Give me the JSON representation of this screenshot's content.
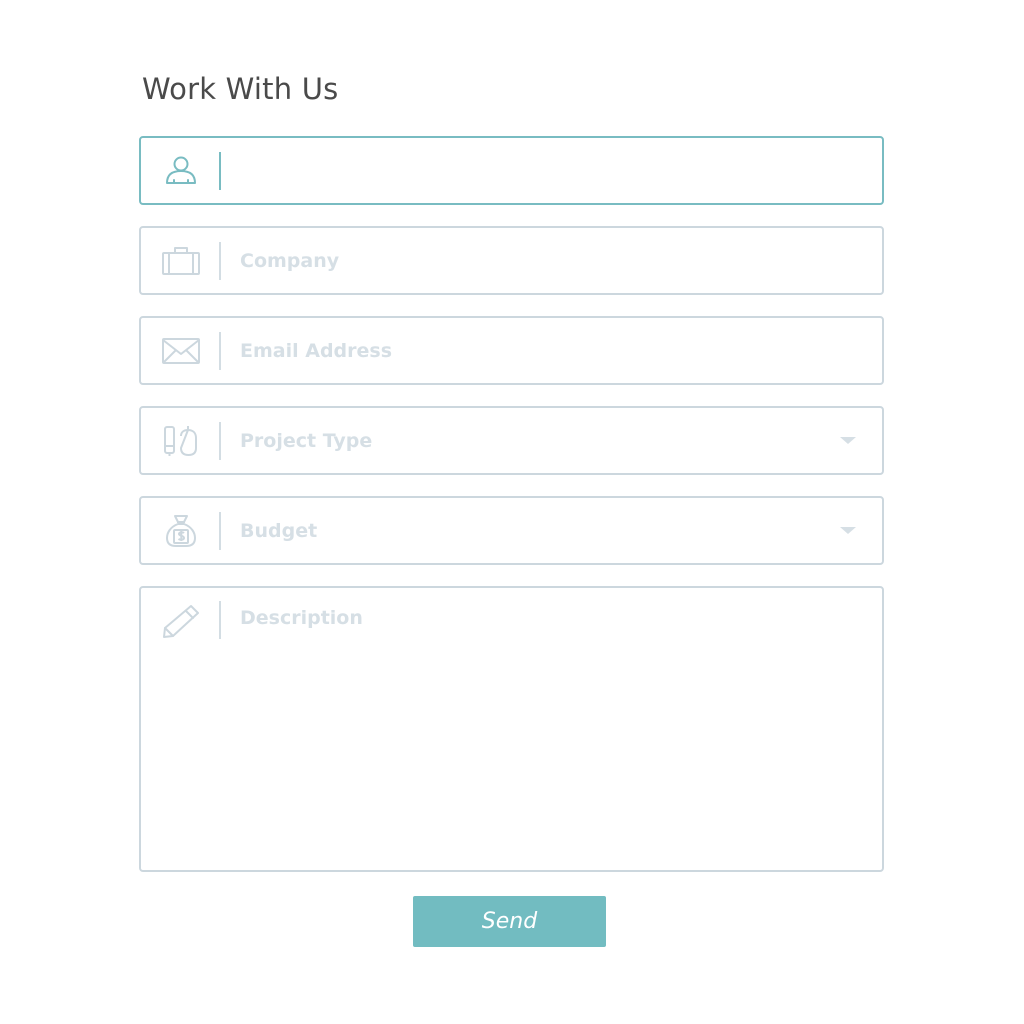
{
  "form": {
    "title": "Work With Us",
    "name": {
      "value": "",
      "icon": "user-icon"
    },
    "company": {
      "placeholder": "Company",
      "icon": "briefcase-icon"
    },
    "email": {
      "placeholder": "Email Address",
      "icon": "envelope-icon"
    },
    "project_type": {
      "label": "Project Type",
      "icon": "paint-tools-icon"
    },
    "budget": {
      "label": "Budget",
      "icon": "money-bag-icon"
    },
    "description": {
      "placeholder": "Description",
      "icon": "pencil-icon"
    },
    "send_label": "Send"
  },
  "colors": {
    "accent": "#72bcc1",
    "active_border": "#79bcc2",
    "border": "#ccd7de",
    "placeholder": "#d6dfe5",
    "title": "#4a4a4a"
  }
}
